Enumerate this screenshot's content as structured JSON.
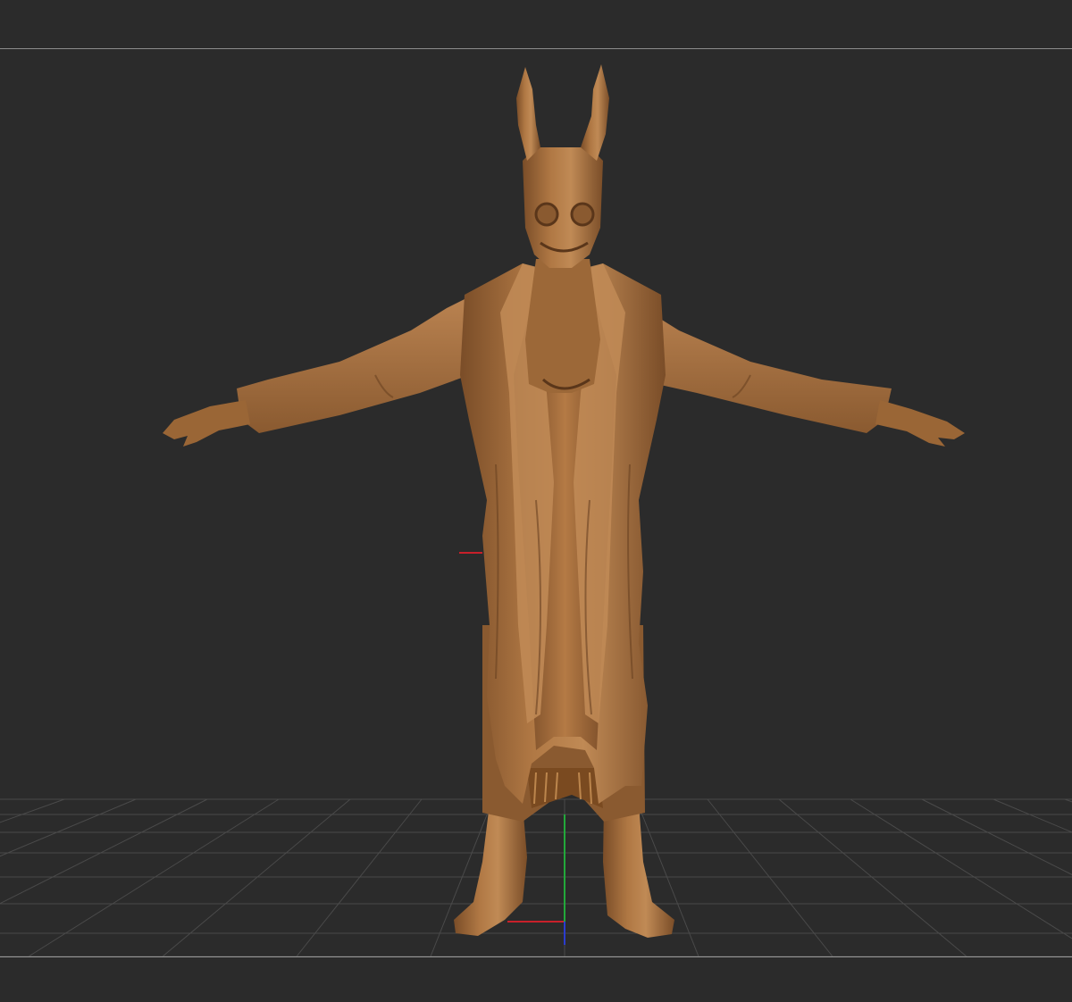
{
  "viewport": {
    "background": "#2b2b2b",
    "grid_color": "#4a4a4a",
    "divider_color": "#8c8c8c"
  },
  "model": {
    "material_color": "#a8703f",
    "highlight_color": "#c8915c",
    "shadow_color": "#6a4222",
    "description": ""
  },
  "gizmo": {
    "x_axis_color": "#c8202a",
    "y_axis_color": "#22a83a",
    "z_axis_color": "#2a3ccf"
  }
}
